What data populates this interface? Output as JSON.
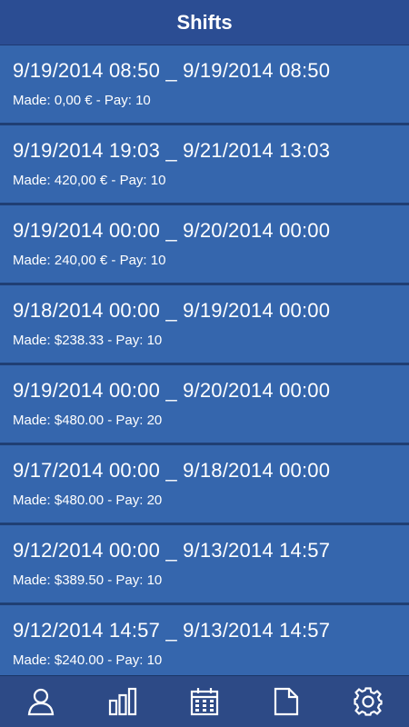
{
  "header": {
    "title": "Shifts"
  },
  "shifts": [
    {
      "range": "9/19/2014 08:50 _ 9/19/2014 08:50",
      "summary": "Made: 0,00 € - Pay: 10"
    },
    {
      "range": "9/19/2014 19:03 _ 9/21/2014 13:03",
      "summary": "Made: 420,00 € - Pay: 10"
    },
    {
      "range": "9/19/2014 00:00 _ 9/20/2014 00:00",
      "summary": "Made: 240,00 € - Pay: 10"
    },
    {
      "range": "9/18/2014 00:00 _ 9/19/2014 00:00",
      "summary": "Made: $238.33 - Pay: 10"
    },
    {
      "range": "9/19/2014 00:00 _ 9/20/2014 00:00",
      "summary": "Made: $480.00 - Pay: 20"
    },
    {
      "range": "9/17/2014 00:00 _ 9/18/2014 00:00",
      "summary": "Made: $480.00 - Pay: 20"
    },
    {
      "range": "9/12/2014 00:00 _ 9/13/2014 14:57",
      "summary": "Made: $389.50 - Pay: 10"
    },
    {
      "range": "9/12/2014 14:57 _ 9/13/2014 14:57",
      "summary": "Made: $240.00 - Pay: 10"
    }
  ],
  "tabbar": {
    "tabs": [
      {
        "icon": "person-icon"
      },
      {
        "icon": "bar-chart-icon"
      },
      {
        "icon": "calendar-icon"
      },
      {
        "icon": "document-icon"
      },
      {
        "icon": "gear-icon"
      }
    ]
  },
  "colors": {
    "header_bg": "#2b4d93",
    "row_bg": "#3566ad",
    "row_divider": "#1f3f74",
    "tabbar_bg": "#2d4a86",
    "text": "#ffffff"
  }
}
